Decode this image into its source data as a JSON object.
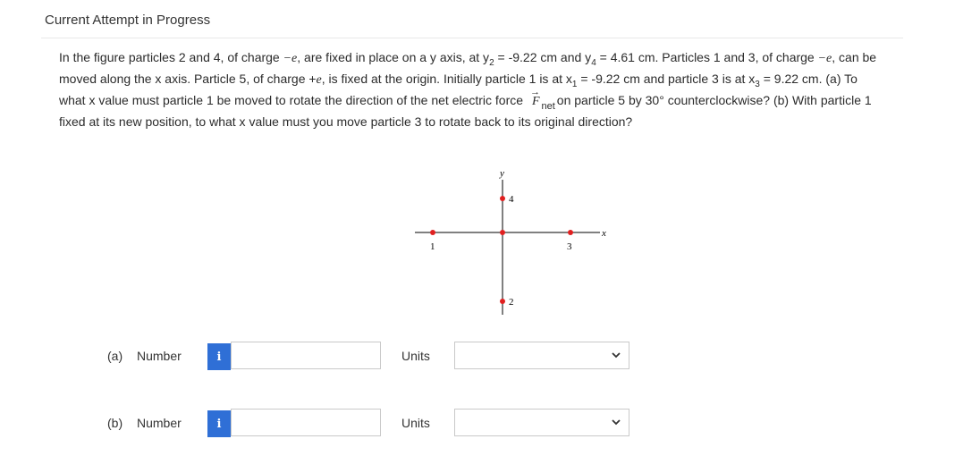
{
  "header": {
    "title": "Current Attempt in Progress"
  },
  "question": {
    "p1": "In the figure particles 2 and 4, of charge ",
    "neg_e": "−e",
    "p2": ", are fixed in place on a y axis, at y",
    "sub2": "2",
    "p3": " = -9.22 cm and y",
    "sub4": "4",
    "p4": " = 4.61 cm. Particles 1 and 3, of charge ",
    "neg_e2": "−e",
    "p5": ", can be moved along the x axis. Particle 5, of charge +",
    "pos_e": "e",
    "p6": ", is fixed at the origin. Initially particle 1 is at x",
    "sub1": "1",
    "p7": " = -9.22 cm and particle 3 is at x",
    "sub3": "3",
    "p8": " = 9.22 cm. (a) To what x value must particle 1 be moved to rotate the direction of the net electric force",
    "vecF": "F",
    "net": "net",
    "p9": "on particle 5 by 30° counterclockwise? (b) With particle 1 fixed at its new position, to what x value must you move particle 3 to rotate back to its original direction?"
  },
  "figure": {
    "axis_y": "y",
    "axis_x": "x",
    "p1": "1",
    "p2": "2",
    "p3": "3",
    "p4": "4",
    "particle_color": "#e02020"
  },
  "answers": {
    "a": {
      "part": "(a)",
      "number_label": "Number",
      "info": "i",
      "value": "",
      "units_label": "Units",
      "units_value": ""
    },
    "b": {
      "part": "(b)",
      "number_label": "Number",
      "info": "i",
      "value": "",
      "units_label": "Units",
      "units_value": ""
    }
  }
}
